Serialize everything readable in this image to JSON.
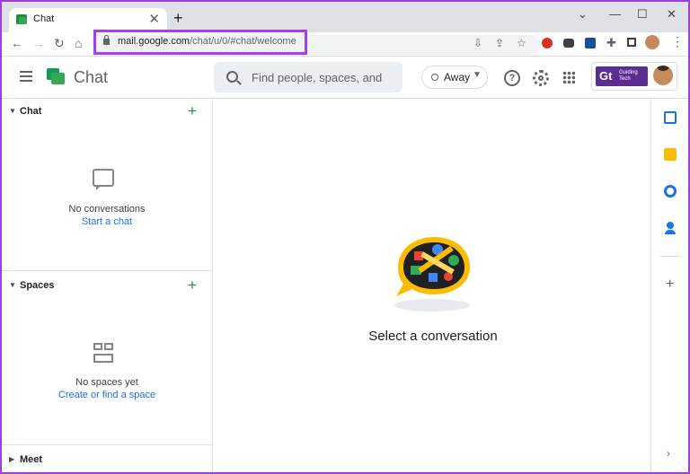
{
  "browser": {
    "tab_title": "Chat",
    "tab_close": "✕",
    "new_tab": "+",
    "window_controls": {
      "minimize": "⌄",
      "min": "—",
      "max": "☐",
      "close": "✕"
    },
    "url_host": "mail.google.com",
    "url_path": "/chat/u/0/#chat/welcome"
  },
  "app": {
    "title": "Chat",
    "search_placeholder": "Find people, spaces, and",
    "status_label": "Away",
    "brand_letters": "Gt",
    "brand_text": "Guiding Tech"
  },
  "sidebar": {
    "chat": {
      "title": "Chat",
      "empty_text": "No conversations",
      "action_link": "Start a chat"
    },
    "spaces": {
      "title": "Spaces",
      "empty_text": "No spaces yet",
      "action_link": "Create or find a space"
    },
    "meet": {
      "title": "Meet"
    }
  },
  "main": {
    "empty_message": "Select a conversation"
  },
  "colors": {
    "accent_green": "#1e8e3e",
    "link_blue": "#1a73e8",
    "highlight_purple": "#a63ff0"
  }
}
